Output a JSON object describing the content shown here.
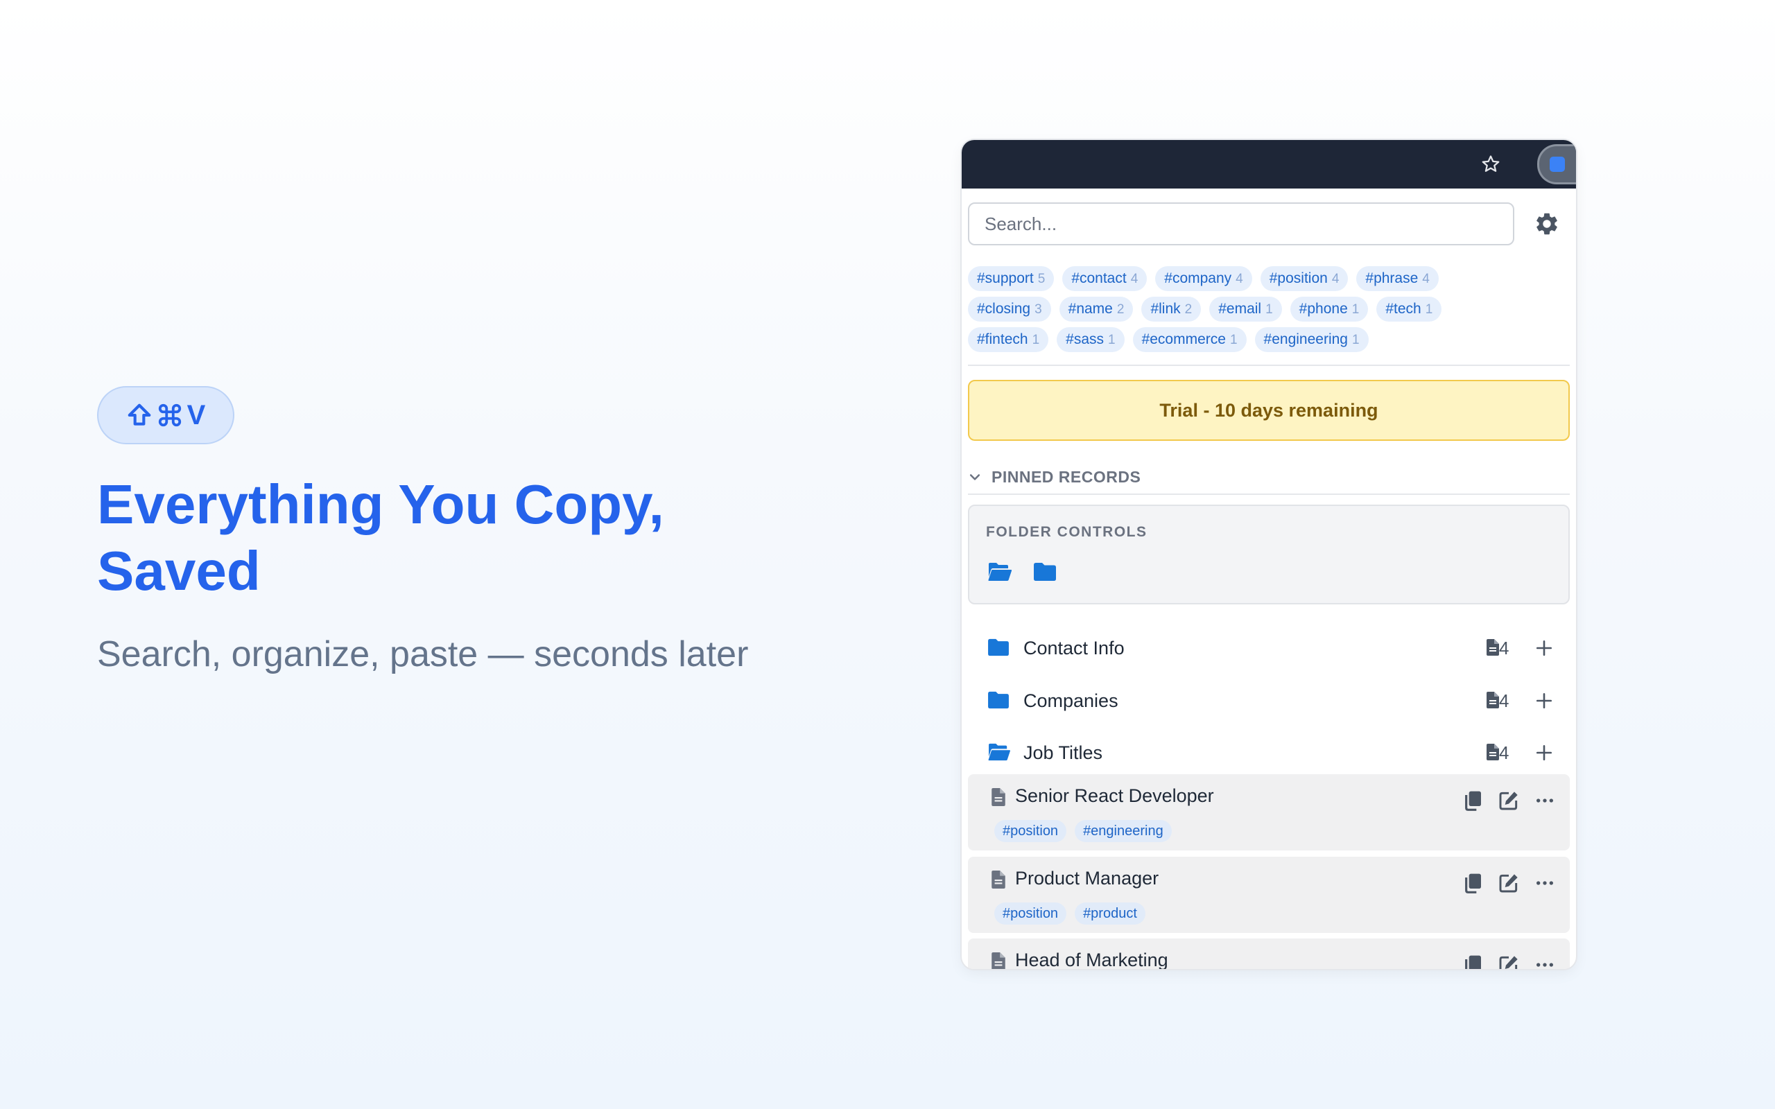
{
  "hero": {
    "shortcut_key": "V",
    "headline_line1": "Everything You Copy,",
    "headline_line2": "Saved",
    "subline": "Search, organize, paste — seconds later"
  },
  "popup": {
    "search": {
      "placeholder": "Search..."
    },
    "tags": [
      {
        "label": "#support",
        "count": "5"
      },
      {
        "label": "#contact",
        "count": "4"
      },
      {
        "label": "#company",
        "count": "4"
      },
      {
        "label": "#position",
        "count": "4"
      },
      {
        "label": "#phrase",
        "count": "4"
      },
      {
        "label": "#closing",
        "count": "3"
      },
      {
        "label": "#name",
        "count": "2"
      },
      {
        "label": "#link",
        "count": "2"
      },
      {
        "label": "#email",
        "count": "1"
      },
      {
        "label": "#phone",
        "count": "1"
      },
      {
        "label": "#tech",
        "count": "1"
      },
      {
        "label": "#fintech",
        "count": "1"
      },
      {
        "label": "#sass",
        "count": "1"
      },
      {
        "label": "#ecommerce",
        "count": "1"
      },
      {
        "label": "#engineering",
        "count": "1"
      }
    ],
    "trial_banner": "Trial - 10 days remaining",
    "pinned_header": "PINNED RECORDS",
    "folder_controls_label": "FOLDER CONTROLS",
    "folders": [
      {
        "name": "Contact Info",
        "count": "4",
        "open": false
      },
      {
        "name": "Companies",
        "count": "4",
        "open": false
      },
      {
        "name": "Job Titles",
        "count": "4",
        "open": true
      }
    ],
    "records": [
      {
        "title": "Senior React Developer",
        "tags": [
          "#position",
          "#engineering"
        ]
      },
      {
        "title": "Product Manager",
        "tags": [
          "#position",
          "#product"
        ]
      },
      {
        "title": "Head of Marketing",
        "tags": []
      }
    ]
  },
  "colors": {
    "accent": "#2563eb",
    "folder_blue": "#1877d8",
    "trial_bg": "#fef4c3",
    "trial_border": "#f2c94c",
    "browser_bar": "#1e2637"
  }
}
